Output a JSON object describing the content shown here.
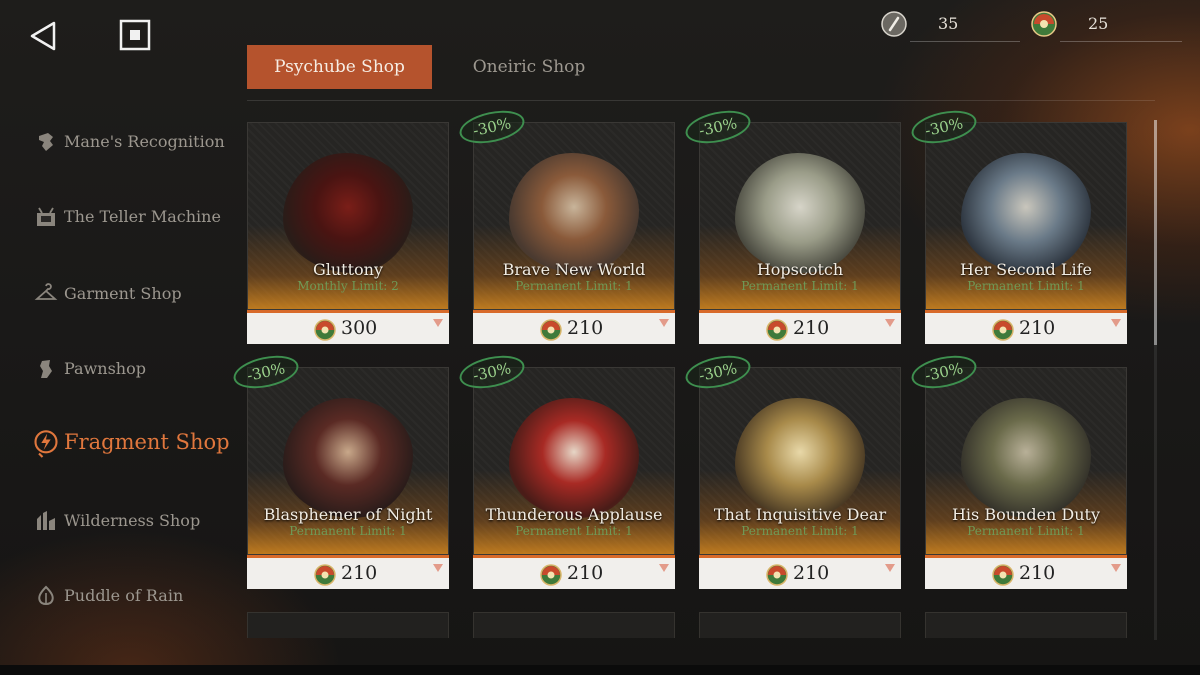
{
  "currencies": [
    {
      "icon": "oneiric-token-icon",
      "value": "35"
    },
    {
      "icon": "psychube-token-icon",
      "value": "25"
    }
  ],
  "tabs": [
    {
      "label": "Psychube Shop",
      "active": true
    },
    {
      "label": "Oneiric Shop",
      "active": false
    }
  ],
  "sidebar": {
    "items": [
      {
        "label": "Mane's Recognition",
        "icon": "mane-icon"
      },
      {
        "label": "The Teller Machine",
        "icon": "teller-icon"
      },
      {
        "label": "Garment Shop",
        "icon": "hanger-icon"
      },
      {
        "label": "Pawnshop",
        "icon": "pawn-icon"
      },
      {
        "label": "Fragment Shop",
        "icon": "fragment-icon",
        "active": true
      },
      {
        "label": "Wilderness Shop",
        "icon": "wilderness-icon"
      },
      {
        "label": "Puddle of Rain",
        "icon": "rain-icon"
      }
    ]
  },
  "items": [
    {
      "name": "Gluttony",
      "limit": "Monthly Limit: 2",
      "price": "300",
      "discount": ""
    },
    {
      "name": "Brave New World",
      "limit": "Permanent Limit: 1",
      "price": "210",
      "discount": "-30%"
    },
    {
      "name": "Hopscotch",
      "limit": "Permanent Limit: 1",
      "price": "210",
      "discount": "-30%"
    },
    {
      "name": "Her Second Life",
      "limit": "Permanent Limit: 1",
      "price": "210",
      "discount": "-30%"
    },
    {
      "name": "Blasphemer of Night",
      "limit": "Permanent Limit: 1",
      "price": "210",
      "discount": "-30%"
    },
    {
      "name": "Thunderous Applause",
      "limit": "Permanent Limit: 1",
      "price": "210",
      "discount": "-30%"
    },
    {
      "name": "That Inquisitive Dear",
      "limit": "Permanent Limit: 1",
      "price": "210",
      "discount": "-30%"
    },
    {
      "name": "His Bounden Duty",
      "limit": "Permanent Limit: 1",
      "price": "210",
      "discount": "-30%"
    }
  ],
  "colors": {
    "accent": "#b5532d",
    "active_nav": "#e0773d",
    "discount": "#3e8f4f",
    "limit_text": "#6f9a57"
  }
}
